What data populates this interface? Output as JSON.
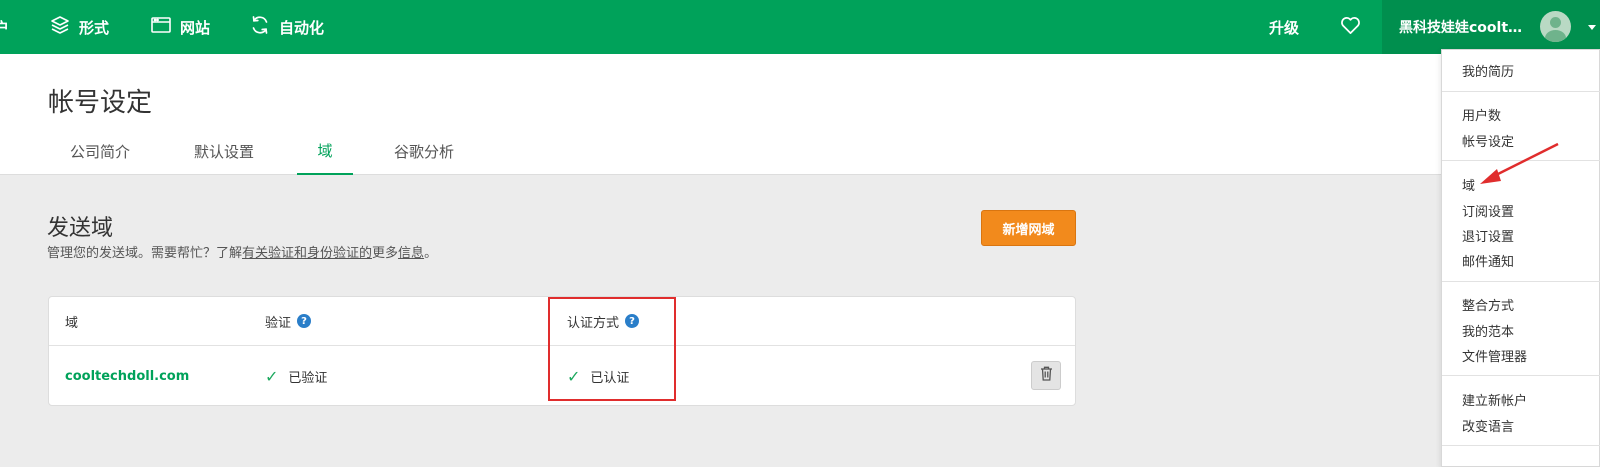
{
  "nav": {
    "partial_item": "户",
    "items": [
      {
        "label": "形式",
        "icon": "layers-icon"
      },
      {
        "label": "网站",
        "icon": "browser-window-icon"
      },
      {
        "label": "自动化",
        "icon": "refresh-cycle-icon"
      }
    ],
    "upgrade_label": "升级",
    "favorite_icon": "heart-icon",
    "user_name": "黑科技娃娃cooltec...",
    "brand_color": "#00a25a"
  },
  "header": {
    "title": "帐号设定",
    "tabs": [
      {
        "label": "公司简介",
        "active": false
      },
      {
        "label": "默认设置",
        "active": false
      },
      {
        "label": "域",
        "active": true
      },
      {
        "label": "谷歌分析",
        "active": false
      }
    ]
  },
  "sending": {
    "title": "发送域",
    "desc_prefix": "管理您的发送域。需要帮忙？了解",
    "desc_link1": "有关验证和身份验证的",
    "desc_mid": "更多",
    "desc_link2": "信息",
    "desc_suffix": "。",
    "add_button": "新增网域"
  },
  "table": {
    "headers": {
      "domain": "域",
      "verify": "验证",
      "auth": "认证方式"
    },
    "rows": [
      {
        "domain": "cooltechdoll.com",
        "verify": "已验证",
        "auth": "已认证"
      }
    ]
  },
  "menu": {
    "groups": [
      [
        "我的简历"
      ],
      [
        "用户数",
        "帐号设定"
      ],
      [
        "域",
        "订阅设置",
        "退订设置",
        "邮件通知"
      ],
      [
        "整合方式",
        "我的范本",
        "文件管理器"
      ],
      [
        "建立新帐户",
        "改变语言"
      ]
    ]
  },
  "annotation_color": "#e02d2d"
}
